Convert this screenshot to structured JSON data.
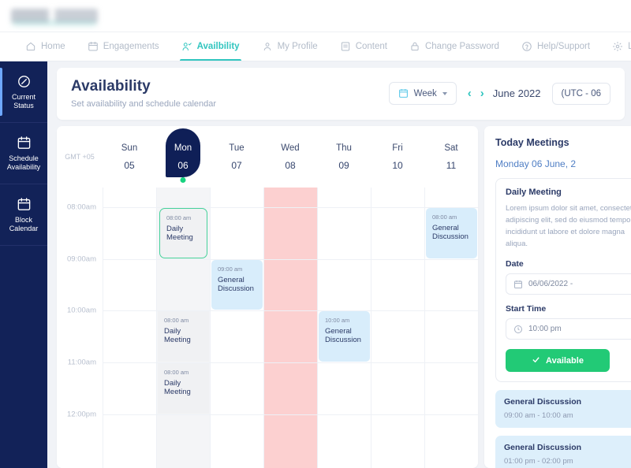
{
  "topbar": {
    "logo_alt": "company-logo-redacted"
  },
  "nav": {
    "items": [
      {
        "label": "Home",
        "icon": "home-icon",
        "active": false
      },
      {
        "label": "Engagements",
        "icon": "calendar-icon",
        "active": false
      },
      {
        "label": "Availbility",
        "icon": "user-check-icon",
        "active": true
      },
      {
        "label": "My Profile",
        "icon": "user-icon",
        "active": false
      },
      {
        "label": "Content",
        "icon": "document-icon",
        "active": false
      },
      {
        "label": "Change Password",
        "icon": "lock-icon",
        "active": false
      },
      {
        "label": "Help/Support",
        "icon": "question-circle-icon",
        "active": false
      },
      {
        "label": "Legal/Privacy",
        "icon": "gear-icon",
        "active": false
      }
    ]
  },
  "rail": {
    "items": [
      {
        "line1": "Current",
        "line2": "Status",
        "icon": "edit-badge-icon",
        "active": true
      },
      {
        "line1": "Schedule",
        "line2": "Availability",
        "icon": "calendar-icon",
        "active": false
      },
      {
        "line1": "Block",
        "line2": "Calendar",
        "icon": "calendar-icon",
        "active": false
      }
    ]
  },
  "page": {
    "title": "Availability",
    "subtitle": "Set availability and schedule calendar",
    "view_label": "Week",
    "prev_label": "‹",
    "next_label": "›",
    "month_label": "June 2022",
    "timezone_label": "(UTC - 06"
  },
  "calendar": {
    "gmt_label": "GMT +05",
    "days": [
      {
        "name": "Sun",
        "num": "05",
        "today": false,
        "state": "normal"
      },
      {
        "name": "Mon",
        "num": "06",
        "today": true,
        "state": "tint"
      },
      {
        "name": "Tue",
        "num": "07",
        "today": false,
        "state": "normal"
      },
      {
        "name": "Wed",
        "num": "08",
        "today": false,
        "state": "blocked"
      },
      {
        "name": "Thu",
        "num": "09",
        "today": false,
        "state": "normal"
      },
      {
        "name": "Fri",
        "num": "10",
        "today": false,
        "state": "normal"
      },
      {
        "name": "Sat",
        "num": "11",
        "today": false,
        "state": "normal"
      }
    ],
    "times": [
      "08:00am",
      "09:00am",
      "10:00am",
      "11:00am",
      "12:00pm"
    ],
    "events": [
      {
        "day": 1,
        "row": 0,
        "time": "08:00 am",
        "title": "Daily Meeting",
        "style": "sel"
      },
      {
        "day": 6,
        "row": 0,
        "time": "08:00 am",
        "title": "General Discussion",
        "style": "blue"
      },
      {
        "day": 2,
        "row": 1,
        "time": "09:00 am",
        "title": "General Discussion",
        "style": "blue"
      },
      {
        "day": 1,
        "row": 2,
        "time": "08:00 am",
        "title": "Daily Meeting",
        "style": "gray"
      },
      {
        "day": 4,
        "row": 2,
        "time": "10:00 am",
        "title": "General Discussion",
        "style": "blue"
      },
      {
        "day": 1,
        "row": 3,
        "time": "08:00 am",
        "title": "Daily Meeting",
        "style": "gray"
      }
    ]
  },
  "right_panel": {
    "title": "Today Meetings",
    "date": "Monday 06 June, 2",
    "meeting": {
      "title": "Daily Meeting",
      "description": "Lorem ipsum dolor sit amet, consectetur adipiscing elit, sed do eiusmod tempor incididunt ut labore et dolore magna aliqua.",
      "date_label": "Date",
      "date_value": "06/06/2022 -",
      "start_label": "Start Time",
      "start_value": "10:00 pm",
      "status_label": "Available"
    },
    "upcoming": [
      {
        "title": "General Discussion",
        "time": "09:00 am - 10:00 am"
      },
      {
        "title": "General Discussion",
        "time": "01:00 pm - 02:00 pm"
      }
    ]
  },
  "colors": {
    "accent": "#31c5bf",
    "navy": "#122258",
    "green": "#22ca76",
    "blocked": "#fcd0d0",
    "event_blue": "#d8edfb"
  }
}
